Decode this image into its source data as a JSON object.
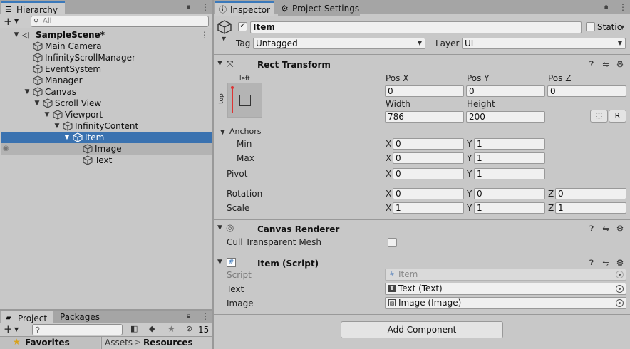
{
  "hierarchy": {
    "tab_label": "Hierarchy",
    "add_label": "+",
    "search_placeholder": "All",
    "scene_name": "SampleScene*",
    "items": [
      {
        "label": "Main Camera"
      },
      {
        "label": "InfinityScrollManager"
      },
      {
        "label": "EventSystem"
      },
      {
        "label": "Manager"
      },
      {
        "label": "Canvas"
      },
      {
        "label": "Scroll View"
      },
      {
        "label": "Viewport"
      },
      {
        "label": "InfinityContent"
      },
      {
        "label": "Item"
      },
      {
        "label": "Image"
      },
      {
        "label": "Text"
      }
    ]
  },
  "project": {
    "tab_project": "Project",
    "tab_packages": "Packages",
    "add_label": "+",
    "hidden_count": "15",
    "favorites_label": "Favorites",
    "breadcrumb_assets": "Assets",
    "breadcrumb_sep": ">",
    "breadcrumb_resources": "Resources"
  },
  "inspector": {
    "tab_inspector": "Inspector",
    "tab_project_settings": "Project Settings",
    "object_name": "Item",
    "static_label": "Static",
    "tag_label": "Tag",
    "tag_value": "Untagged",
    "layer_label": "Layer",
    "layer_value": "UI",
    "rect_transform": {
      "title": "Rect Transform",
      "anchor_preset_left": "left",
      "anchor_preset_top": "top",
      "pos_x_label": "Pos X",
      "pos_y_label": "Pos Y",
      "pos_z_label": "Pos Z",
      "pos_x": "0",
      "pos_y": "0",
      "pos_z": "0",
      "width_label": "Width",
      "height_label": "Height",
      "width": "786",
      "height": "200",
      "raw_button": "R",
      "anchors_label": "Anchors",
      "min_label": "Min",
      "max_label": "Max",
      "min_x": "0",
      "min_y": "1",
      "max_x": "0",
      "max_y": "1",
      "pivot_label": "Pivot",
      "pivot_x": "0",
      "pivot_y": "1",
      "rotation_label": "Rotation",
      "rot_x": "0",
      "rot_y": "0",
      "rot_z": "0",
      "scale_label": "Scale",
      "scale_x": "1",
      "scale_y": "1",
      "scale_z": "1",
      "x_letter": "X",
      "y_letter": "Y",
      "z_letter": "Z"
    },
    "canvas_renderer": {
      "title": "Canvas Renderer",
      "cull_label": "Cull Transparent Mesh"
    },
    "item_script": {
      "title": "Item (Script)",
      "script_label": "Script",
      "script_value": "Item",
      "text_label": "Text",
      "text_value": "Text (Text)",
      "image_label": "Image",
      "image_value": "Image (Image)"
    },
    "add_component": "Add Component"
  },
  "colors": {
    "selection": "#3a72b0",
    "accent_tab": "#3a79bb",
    "panel_bg": "#c8c8c8"
  }
}
